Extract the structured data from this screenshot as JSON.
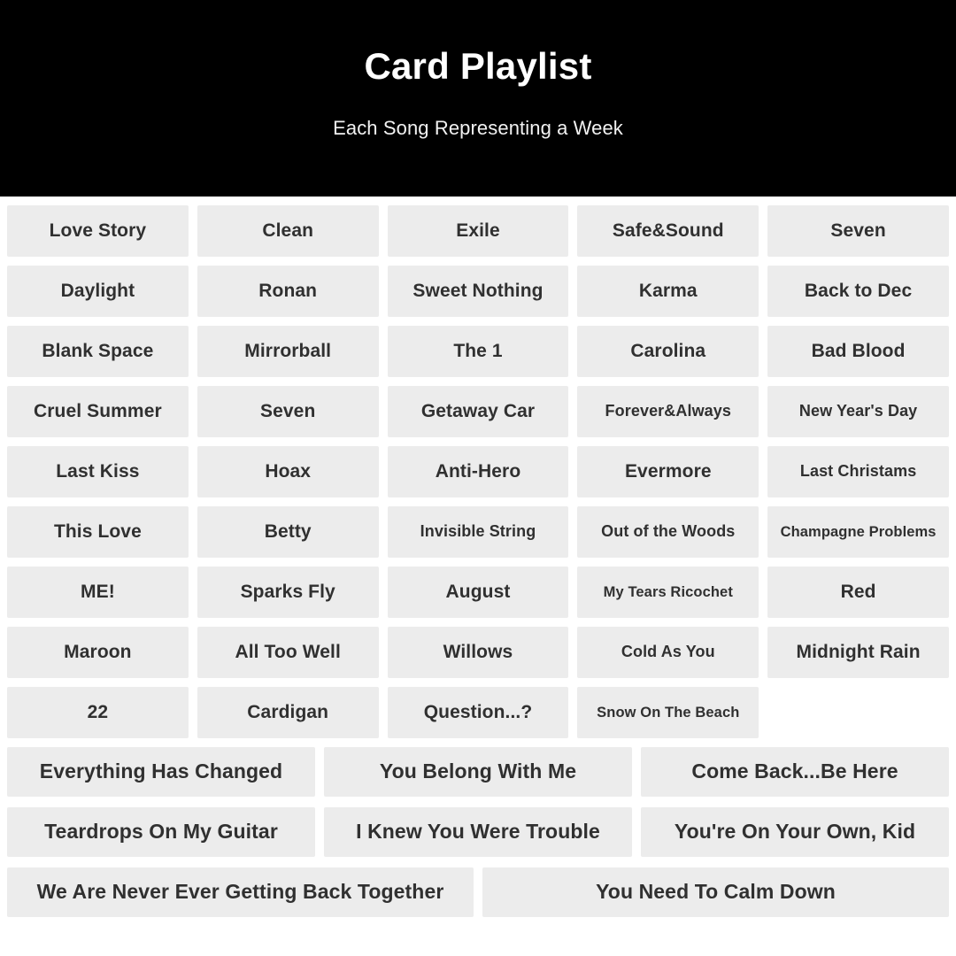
{
  "header": {
    "title": "Card Playlist",
    "subtitle": "Each Song Representing a Week",
    "background_color": "#000000",
    "title_color": "#ffffff"
  },
  "theme": {
    "page_background": "#ffffff",
    "card_background": "#ececec",
    "card_text_color": "#303030"
  },
  "playlist": {
    "rows": [
      {
        "layout": "five-column",
        "cards": [
          {
            "label": "Love Story",
            "size": "md"
          },
          {
            "label": "Clean",
            "size": "md"
          },
          {
            "label": "Exile",
            "size": "md"
          },
          {
            "label": "Safe&Sound",
            "size": "md"
          },
          {
            "label": "Seven",
            "size": "md"
          }
        ]
      },
      {
        "layout": "five-column",
        "cards": [
          {
            "label": "Daylight",
            "size": "md"
          },
          {
            "label": "Ronan",
            "size": "md"
          },
          {
            "label": "Sweet Nothing",
            "size": "md"
          },
          {
            "label": "Karma",
            "size": "md"
          },
          {
            "label": "Back to Dec",
            "size": "md"
          }
        ]
      },
      {
        "layout": "five-column",
        "cards": [
          {
            "label": "Blank Space",
            "size": "md"
          },
          {
            "label": "Mirrorball",
            "size": "md"
          },
          {
            "label": "The 1",
            "size": "md"
          },
          {
            "label": "Carolina",
            "size": "md"
          },
          {
            "label": "Bad Blood",
            "size": "md"
          }
        ]
      },
      {
        "layout": "five-column",
        "cards": [
          {
            "label": "Cruel Summer",
            "size": "md"
          },
          {
            "label": "Seven",
            "size": "md"
          },
          {
            "label": "Getaway Car",
            "size": "md"
          },
          {
            "label": "Forever&Always",
            "size": "sm"
          },
          {
            "label": "New Year's Day",
            "size": "sm"
          }
        ]
      },
      {
        "layout": "five-column",
        "cards": [
          {
            "label": "Last Kiss",
            "size": "md"
          },
          {
            "label": "Hoax",
            "size": "md"
          },
          {
            "label": "Anti-Hero",
            "size": "md"
          },
          {
            "label": "Evermore",
            "size": "md"
          },
          {
            "label": "Last Christams",
            "size": "sm"
          }
        ]
      },
      {
        "layout": "five-column",
        "cards": [
          {
            "label": "This Love",
            "size": "md"
          },
          {
            "label": "Betty",
            "size": "md"
          },
          {
            "label": "Invisible String",
            "size": "sm"
          },
          {
            "label": "Out of the Woods",
            "size": "sm"
          },
          {
            "label": "Champagne Problems",
            "size": "xs"
          }
        ]
      },
      {
        "layout": "five-column",
        "cards": [
          {
            "label": "ME!",
            "size": "md"
          },
          {
            "label": "Sparks Fly",
            "size": "md"
          },
          {
            "label": "August",
            "size": "md"
          },
          {
            "label": "My Tears Ricochet",
            "size": "xs"
          },
          {
            "label": "Red",
            "size": "md"
          }
        ]
      },
      {
        "layout": "five-column",
        "cards": [
          {
            "label": "Maroon",
            "size": "md"
          },
          {
            "label": "All Too Well",
            "size": "md"
          },
          {
            "label": "Willows",
            "size": "md"
          },
          {
            "label": "Cold As You",
            "size": "sm"
          },
          {
            "label": "Midnight Rain",
            "size": "md"
          }
        ]
      },
      {
        "layout": "five-column",
        "cards": [
          {
            "label": "22",
            "size": "md"
          },
          {
            "label": "Cardigan",
            "size": "md"
          },
          {
            "label": "Question...?",
            "size": "md"
          },
          {
            "label": "Snow On The Beach",
            "size": "xs"
          },
          {
            "label": "",
            "size": "spacer"
          }
        ]
      },
      {
        "layout": "three-column",
        "cards": [
          {
            "label": "Everything Has Changed",
            "size": "lg"
          },
          {
            "label": "You Belong With Me",
            "size": "lg"
          },
          {
            "label": "Come Back...Be Here",
            "size": "lg"
          }
        ]
      },
      {
        "layout": "three-column",
        "cards": [
          {
            "label": "Teardrops On My Guitar",
            "size": "lg"
          },
          {
            "label": "I Knew You Were Trouble",
            "size": "lg"
          },
          {
            "label": "You're On Your Own, Kid",
            "size": "lg"
          }
        ]
      },
      {
        "layout": "two-column",
        "cards": [
          {
            "label": "We Are Never Ever Getting Back Together",
            "size": "lg"
          },
          {
            "label": "You Need To Calm Down",
            "size": "lg"
          }
        ]
      }
    ]
  }
}
